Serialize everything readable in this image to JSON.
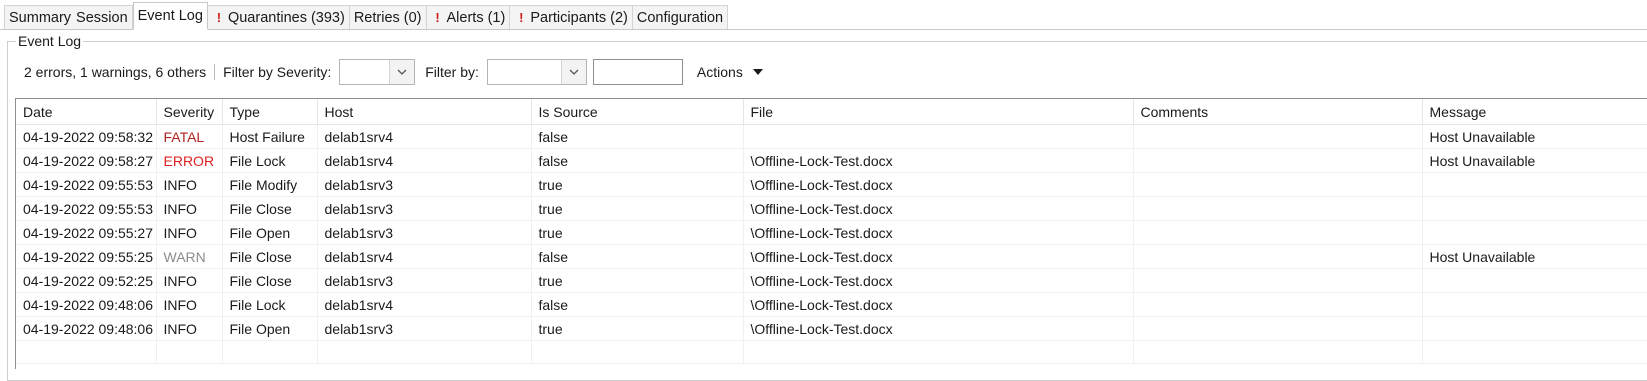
{
  "tabs": [
    {
      "label": "Summary",
      "active": false,
      "warning": false
    },
    {
      "label": "Session",
      "active": false,
      "warning": false
    },
    {
      "label": "Event Log",
      "active": true,
      "warning": false
    },
    {
      "label": "Quarantines (393)",
      "active": false,
      "warning": true
    },
    {
      "label": "Retries (0)",
      "active": false,
      "warning": false
    },
    {
      "label": "Alerts (1)",
      "active": false,
      "warning": true
    },
    {
      "label": "Participants (2)",
      "active": false,
      "warning": true
    },
    {
      "label": "Configuration",
      "active": false,
      "warning": false
    }
  ],
  "group": {
    "title": "Event Log"
  },
  "toolbar": {
    "summary": "2 errors, 1 warnings, 6 others",
    "severity_label": "Filter by Severity:",
    "severity_value": "",
    "filterby_label": "Filter by:",
    "filterby_value": "",
    "filter_text": "",
    "actions_label": "Actions"
  },
  "table": {
    "columns": [
      "Date",
      "Severity",
      "Type",
      "Host",
      "Is Source",
      "File",
      "Comments",
      "Message"
    ],
    "rows": [
      [
        "04-19-2022 09:58:32",
        "FATAL",
        "Host Failure",
        "delab1srv4",
        "false",
        "",
        "",
        "Host Unavailable"
      ],
      [
        "04-19-2022 09:58:27",
        "ERROR",
        "File Lock",
        "delab1srv4",
        "false",
        "\\Offline-Lock-Test.docx",
        "",
        "Host Unavailable"
      ],
      [
        "04-19-2022 09:55:53",
        "INFO",
        "File Modify",
        "delab1srv3",
        "true",
        "\\Offline-Lock-Test.docx",
        "",
        ""
      ],
      [
        "04-19-2022 09:55:53",
        "INFO",
        "File Close",
        "delab1srv3",
        "true",
        "\\Offline-Lock-Test.docx",
        "",
        ""
      ],
      [
        "04-19-2022 09:55:27",
        "INFO",
        "File Open",
        "delab1srv3",
        "true",
        "\\Offline-Lock-Test.docx",
        "",
        ""
      ],
      [
        "04-19-2022 09:55:25",
        "WARN",
        "File Close",
        "delab1srv4",
        "false",
        "\\Offline-Lock-Test.docx",
        "",
        "Host Unavailable"
      ],
      [
        "04-19-2022 09:52:25",
        "INFO",
        "File Close",
        "delab1srv3",
        "true",
        "\\Offline-Lock-Test.docx",
        "",
        ""
      ],
      [
        "04-19-2022 09:48:06",
        "INFO",
        "File Lock",
        "delab1srv4",
        "false",
        "\\Offline-Lock-Test.docx",
        "",
        ""
      ],
      [
        "04-19-2022 09:48:06",
        "INFO",
        "File Open",
        "delab1srv3",
        "true",
        "\\Offline-Lock-Test.docx",
        "",
        ""
      ]
    ]
  },
  "severity_colors": {
    "FATAL": "#b22222",
    "ERROR": "#e02020",
    "WARN": "#8c8c8c",
    "INFO": "#1a1a1a"
  },
  "icons": {
    "tab_warning": "exclamation-icon",
    "combo_arrow": "chevron-down-icon",
    "actions_arrow": "caret-down-icon"
  }
}
